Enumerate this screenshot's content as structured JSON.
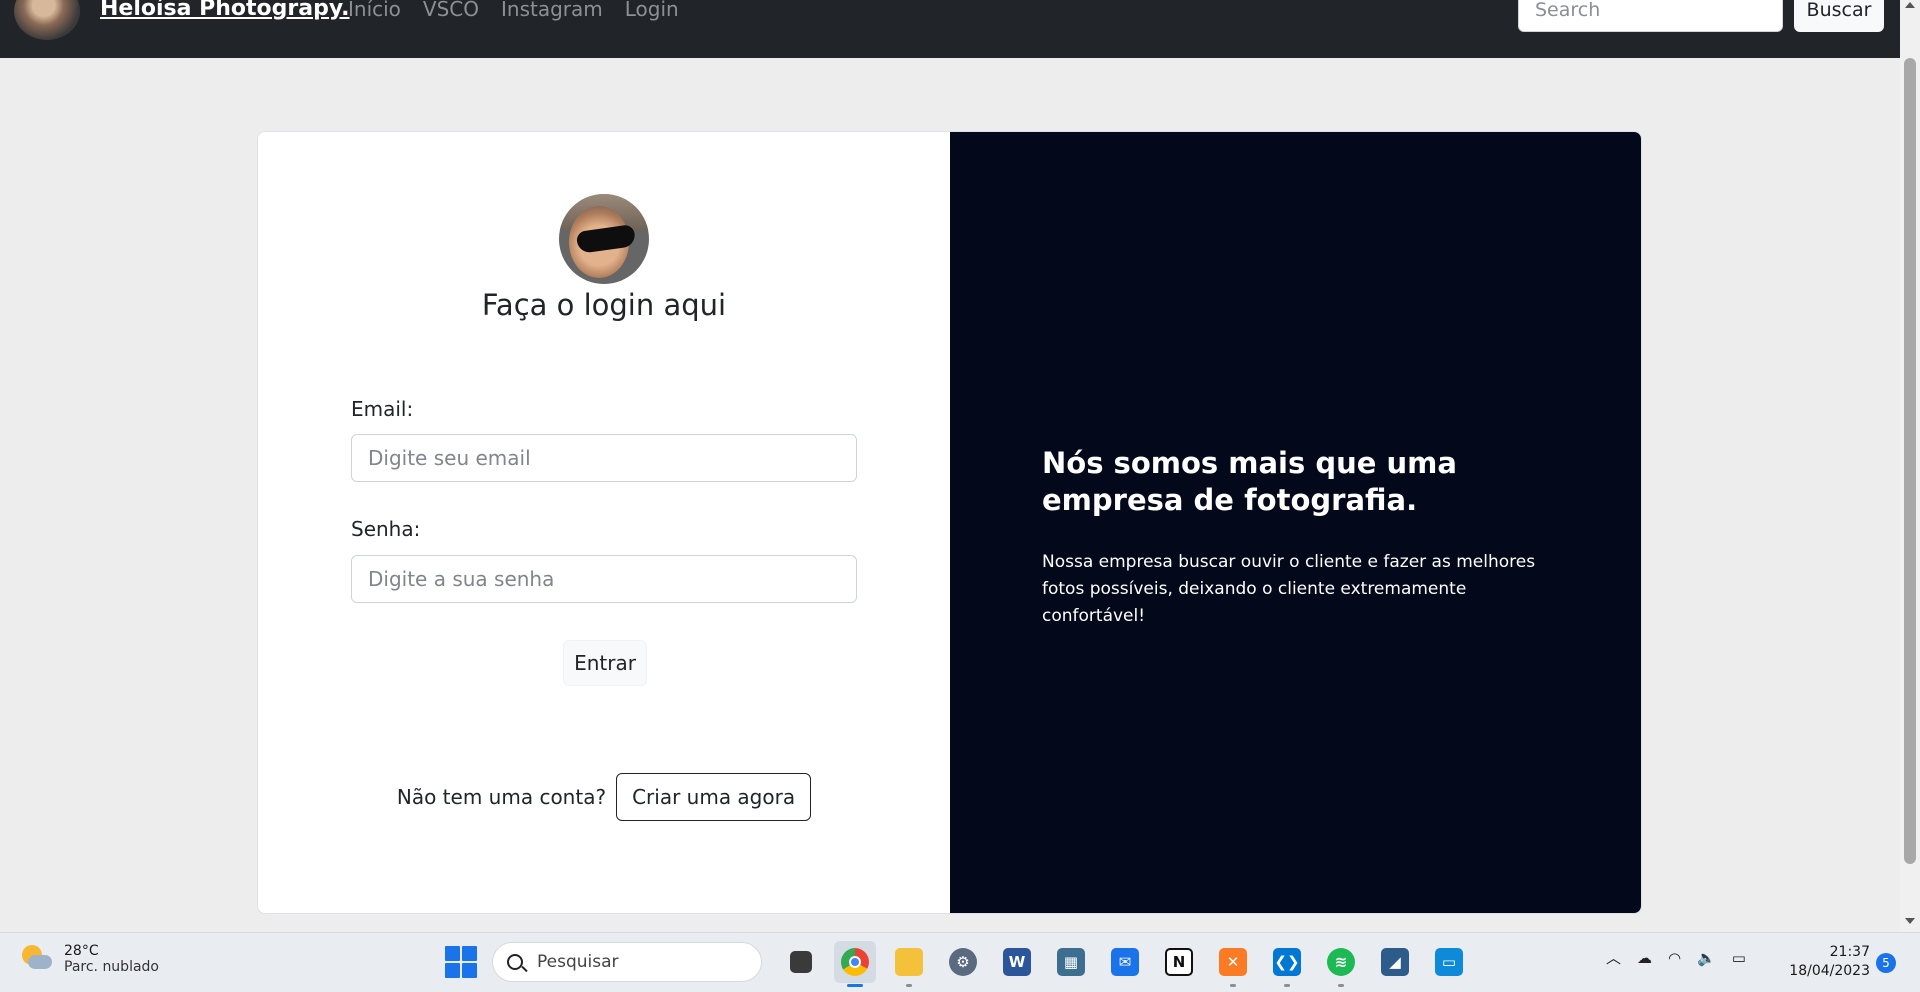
{
  "navbar": {
    "brand": "Heloísa Photograpy.",
    "links": [
      "Início",
      "VSCO",
      "Instagram",
      "Login"
    ],
    "search_placeholder": "Search",
    "search_button": "Buscar"
  },
  "login": {
    "title": "Faça o login aqui",
    "email_label": "Email:",
    "email_placeholder": "Digite seu email",
    "password_label": "Senha:",
    "password_placeholder": "Digite a sua senha",
    "submit_label": "Entrar",
    "no_account_text": "Não tem uma conta?",
    "signup_button": "Criar uma agora"
  },
  "hero": {
    "title": "Nós somos mais que uma empresa de fotografia.",
    "text": "Nossa empresa buscar ouvir o cliente e fazer as melhores fotos possíveis, deixando o cliente extremamente confortável!"
  },
  "taskbar": {
    "weather_temp": "28°C",
    "weather_desc": "Parc. nublado",
    "search_label": "Pesquisar",
    "apps": [
      "chrome-icon",
      "file-explorer-icon",
      "settings-icon",
      "word-icon",
      "calculator-icon",
      "mail-icon",
      "notion-icon",
      "xampp-icon",
      "vscode-icon",
      "spotify-icon",
      "mysql-workbench-icon",
      "remote-desktop-icon"
    ],
    "time": "21:37",
    "date": "18/04/2023",
    "notification_count": "5"
  },
  "colors": {
    "navbar_bg": "#212529",
    "hero_bg": "#03081b",
    "page_bg": "#ededee",
    "accent": "#1a73e8"
  }
}
